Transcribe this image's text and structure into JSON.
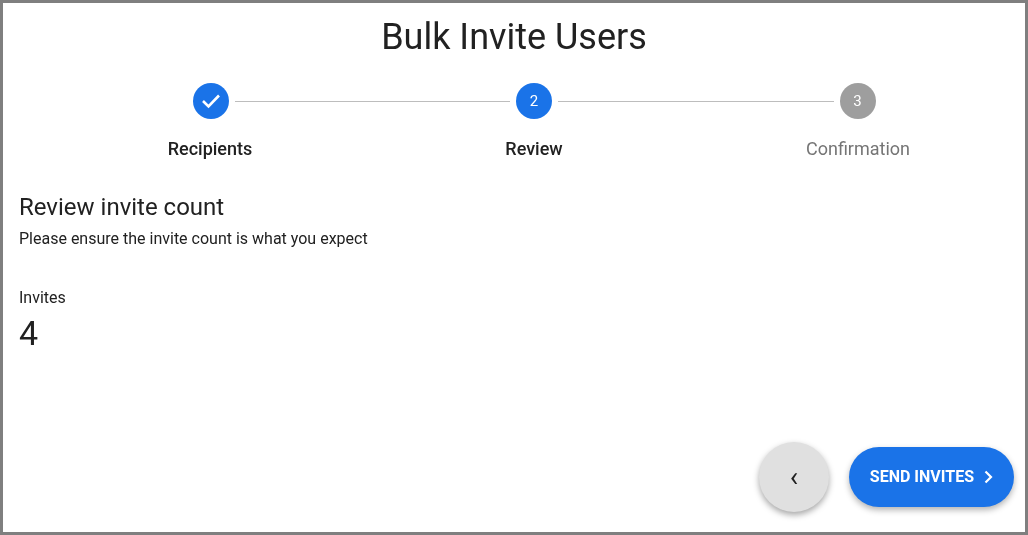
{
  "title": "Bulk Invite Users",
  "steps": [
    {
      "kind": "completed",
      "label": "Recipients"
    },
    {
      "kind": "active",
      "number": "2",
      "label": "Review"
    },
    {
      "kind": "pending",
      "number": "3",
      "label": "Confirmation"
    }
  ],
  "section": {
    "heading": "Review invite count",
    "description": "Please ensure the invite count is what you expect"
  },
  "stat": {
    "label": "Invites",
    "value": "4"
  },
  "actions": {
    "back": {
      "icon": "‹"
    },
    "send": {
      "label": "SEND INVITES"
    }
  }
}
